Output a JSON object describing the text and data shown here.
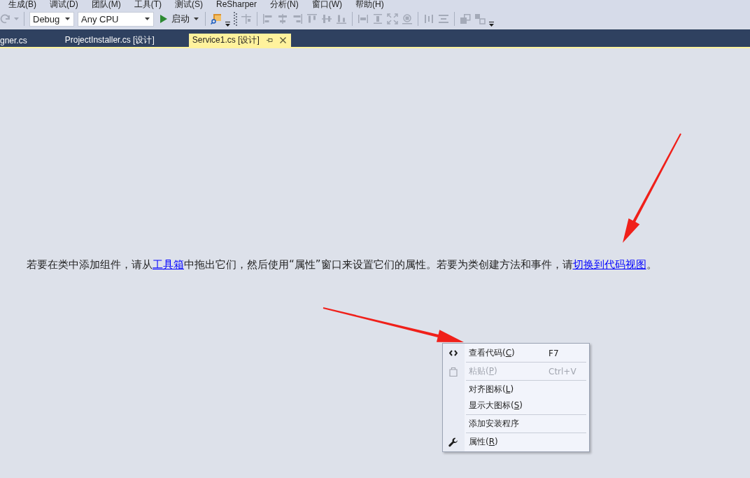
{
  "menu_bar": {
    "items": [
      "生成(B)",
      "调试(D)",
      "团队(M)",
      "工具(T)",
      "测试(S)",
      "ReSharper",
      "分析(N)",
      "窗口(W)",
      "帮助(H)"
    ]
  },
  "toolbar": {
    "redo": {
      "disabled": true
    },
    "configuration": "Debug",
    "platform": "Any CPU",
    "start": {
      "label": "启动"
    },
    "layout_tools": {
      "disabled": true
    }
  },
  "tabs": [
    {
      "label": "gner.cs",
      "selected": false
    },
    {
      "label": "ProjectInstaller.cs [设计]",
      "selected": false
    },
    {
      "label": "Service1.cs [设计]",
      "selected": true
    }
  ],
  "designer": {
    "message": [
      {
        "kind": "text",
        "text": "若要在类中添加组件，请从"
      },
      {
        "kind": "link",
        "text": "工具箱"
      },
      {
        "kind": "text",
        "text": "中拖出它们，然后使用“属性”窗口来设置它们的属性。若要为类创建方法和事件，请"
      },
      {
        "kind": "link",
        "text": "切换到代码视图"
      },
      {
        "kind": "text",
        "text": "。"
      }
    ]
  },
  "context_menu": {
    "groups": [
      {
        "items": [
          {
            "label": "查看代码(",
            "access_key": "C",
            "label_end": ")",
            "shortcut": "F7",
            "disabled": false
          }
        ]
      },
      {
        "items": [
          {
            "label": "粘贴(",
            "access_key": "P",
            "label_end": ")",
            "shortcut": "Ctrl+V",
            "disabled": true
          }
        ]
      },
      {
        "items": [
          {
            "label": "对齐图标(",
            "access_key": "L",
            "label_end": ")",
            "disabled": false
          },
          {
            "label": "显示大图标(",
            "access_key": "S",
            "label_end": ")",
            "disabled": false
          }
        ]
      },
      {
        "items": [
          {
            "label": "添加安装程序",
            "disabled": false
          }
        ]
      },
      {
        "items": [
          {
            "label": "属性(",
            "access_key": "R",
            "label_end": ")",
            "disabled": false
          }
        ]
      }
    ]
  }
}
